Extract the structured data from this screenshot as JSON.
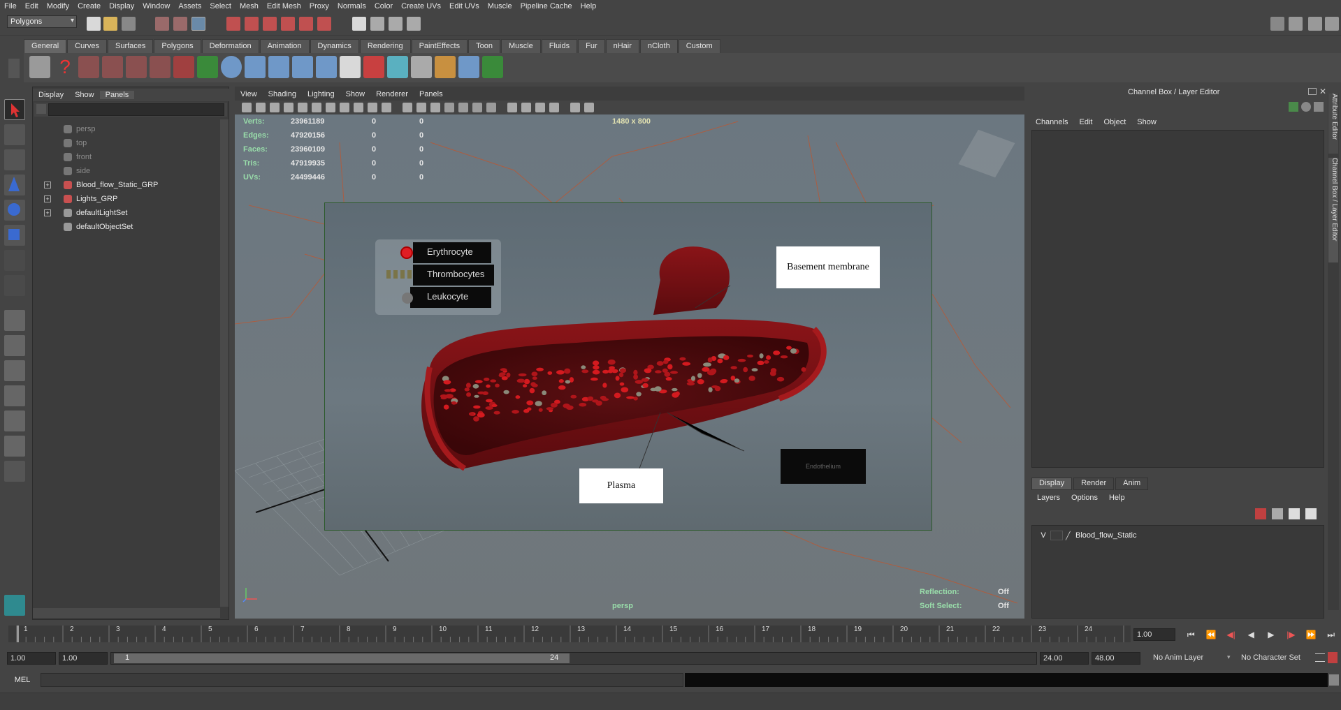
{
  "menubar": [
    "File",
    "Edit",
    "Modify",
    "Create",
    "Display",
    "Window",
    "Assets",
    "Select",
    "Mesh",
    "Edit Mesh",
    "Proxy",
    "Normals",
    "Color",
    "Create UVs",
    "Edit UVs",
    "Muscle",
    "Pipeline Cache",
    "Help"
  ],
  "mode_selector": "Polygons",
  "shelf_tabs": [
    "General",
    "Curves",
    "Surfaces",
    "Polygons",
    "Deformation",
    "Animation",
    "Dynamics",
    "Rendering",
    "PaintEffects",
    "Toon",
    "Muscle",
    "Fluids",
    "Fur",
    "nHair",
    "nCloth",
    "Custom"
  ],
  "outliner": {
    "menu": [
      "Display",
      "Show",
      "Panels"
    ],
    "items": [
      {
        "label": "persp",
        "dim": true,
        "expandable": false
      },
      {
        "label": "top",
        "dim": true,
        "expandable": false
      },
      {
        "label": "front",
        "dim": true,
        "expandable": false
      },
      {
        "label": "side",
        "dim": true,
        "expandable": false
      },
      {
        "label": "Blood_flow_Static_GRP",
        "dim": false,
        "expandable": true
      },
      {
        "label": "Lights_GRP",
        "dim": false,
        "expandable": true
      },
      {
        "label": "defaultLightSet",
        "dim": false,
        "expandable": true
      },
      {
        "label": "defaultObjectSet",
        "dim": false,
        "expandable": false
      }
    ]
  },
  "viewport": {
    "menu": [
      "View",
      "Shading",
      "Lighting",
      "Show",
      "Renderer",
      "Panels"
    ],
    "resolution": "1480 x 800",
    "camera": "persp",
    "hud": [
      {
        "key": "Verts:",
        "value": "23961189",
        "c1": "0",
        "c2": "0"
      },
      {
        "key": "Edges:",
        "value": "47920156",
        "c1": "0",
        "c2": "0"
      },
      {
        "key": "Faces:",
        "value": "23960109",
        "c1": "0",
        "c2": "0"
      },
      {
        "key": "Tris:",
        "value": "47919935",
        "c1": "0",
        "c2": "0"
      },
      {
        "key": "UVs:",
        "value": "24499446",
        "c1": "0",
        "c2": "0"
      }
    ],
    "reflection_label": "Reflection:",
    "reflection_value": "Off",
    "soft_select_label": "Soft Select:",
    "soft_select_value": "Off",
    "legend": [
      "Erythrocyte",
      "Thrombocytes",
      "Leukocyte"
    ],
    "labels": {
      "basement": "Basement membrane",
      "plasma": "Plasma",
      "endothelium": "Endothelium"
    }
  },
  "channel_box": {
    "title": "Channel Box / Layer Editor",
    "menu": [
      "Channels",
      "Edit",
      "Object",
      "Show"
    ],
    "side_tabs": [
      "Attribute Editor",
      "Channel Box / Layer Editor"
    ]
  },
  "layer_editor": {
    "tabs": [
      "Display",
      "Render",
      "Anim"
    ],
    "menu": [
      "Layers",
      "Options",
      "Help"
    ],
    "layer": {
      "visible": "V",
      "name": "Blood_flow_Static"
    }
  },
  "timeline": {
    "ticks": [
      "1",
      "2",
      "3",
      "4",
      "5",
      "6",
      "7",
      "8",
      "9",
      "10",
      "11",
      "12",
      "13",
      "14",
      "15",
      "16",
      "17",
      "18",
      "19",
      "20",
      "21",
      "22",
      "23",
      "24"
    ],
    "current_frame": "1.00"
  },
  "range": {
    "start": "1.00",
    "playback_start": "1.00",
    "slider_start": "1",
    "slider_end": "24",
    "playback_end": "24.00",
    "end": "48.00",
    "anim_layer": "No Anim Layer",
    "character_set": "No Character Set"
  },
  "mel": {
    "label": "MEL"
  }
}
